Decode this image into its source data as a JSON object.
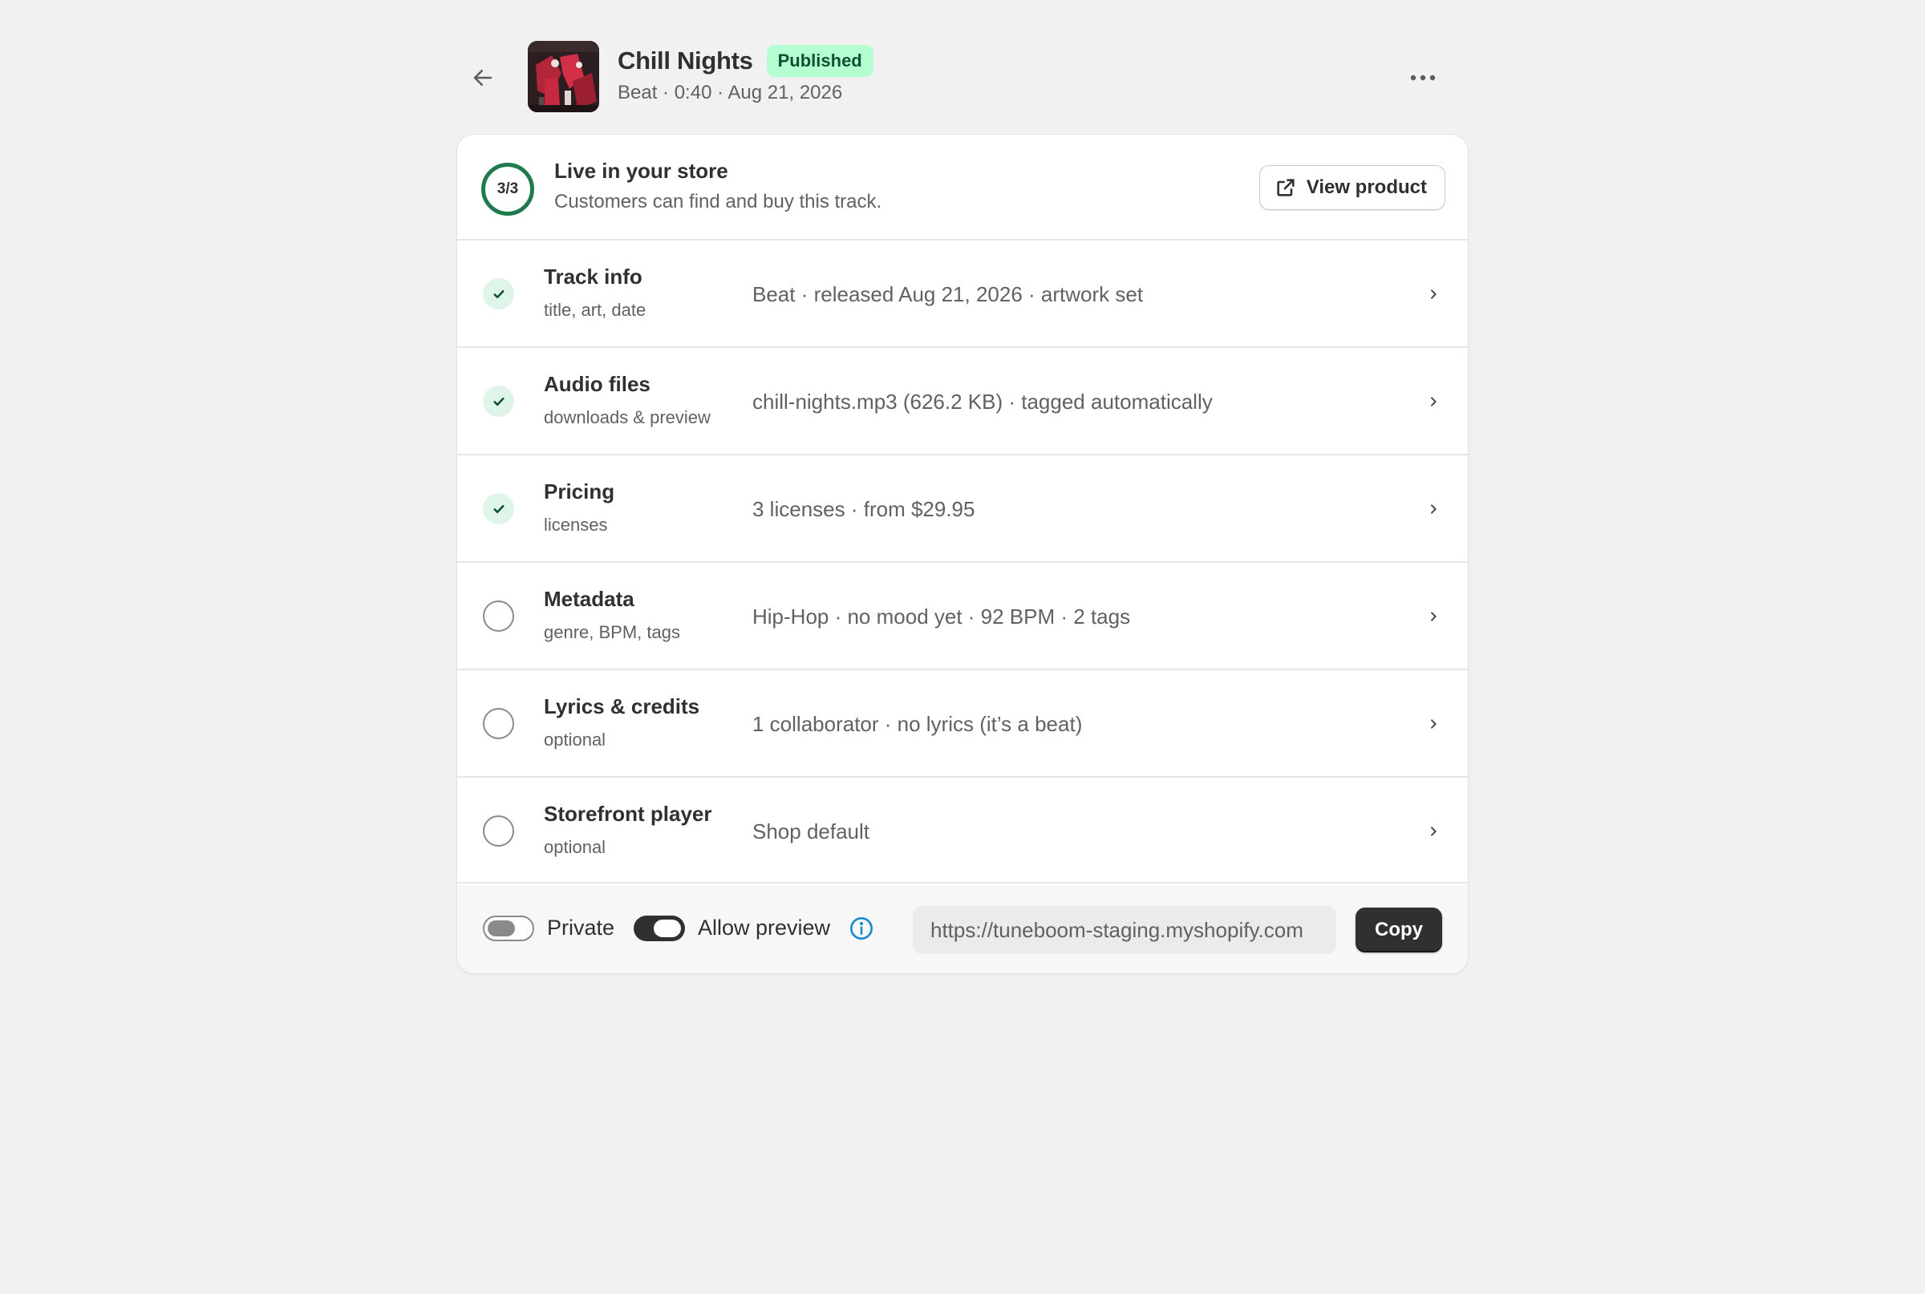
{
  "header": {
    "title": "Chill Nights",
    "status_badge": "Published",
    "subtitle": "Beat · 0:40 · Aug 21, 2026",
    "back_icon": "arrow-left-icon",
    "more_icon": "more-horizontal-icon"
  },
  "status": {
    "progress_label": "3/3",
    "title": "Live in your store",
    "description": "Customers can find and buy this track.",
    "view_product_label": "View product",
    "view_product_icon": "external-link-icon"
  },
  "steps": [
    {
      "title": "Track info",
      "hint": "title, art, date",
      "summary": "Beat · released Aug 21, 2026 · artwork set",
      "done": true
    },
    {
      "title": "Audio files",
      "hint": "downloads & preview",
      "summary": "chill-nights.mp3 (626.2 KB) · tagged automatically",
      "done": true
    },
    {
      "title": "Pricing",
      "hint": "licenses",
      "summary": "3 licenses · from $29.95",
      "done": true
    },
    {
      "title": "Metadata",
      "hint": "genre, BPM, tags",
      "summary": "Hip-Hop · no mood yet · 92 BPM · 2 tags",
      "done": false
    },
    {
      "title": "Lyrics & credits",
      "hint": "optional",
      "summary": "1 collaborator · no lyrics (it’s a beat)",
      "done": false
    },
    {
      "title": "Storefront player",
      "hint": "optional",
      "summary": "Shop default",
      "done": false
    }
  ],
  "footer": {
    "private_label": "Private",
    "private_on": false,
    "preview_label": "Allow preview",
    "preview_on": true,
    "url_value": "https://tuneboom-staging.myshopify.com",
    "copy_label": "Copy"
  },
  "colors": {
    "accent_green": "#1f7a4d",
    "badge_bg": "#b4fed2",
    "badge_text": "#0c5132",
    "info_blue": "#1b8bd0",
    "primary_button": "#303030",
    "page_bg": "#f1f1f1"
  }
}
